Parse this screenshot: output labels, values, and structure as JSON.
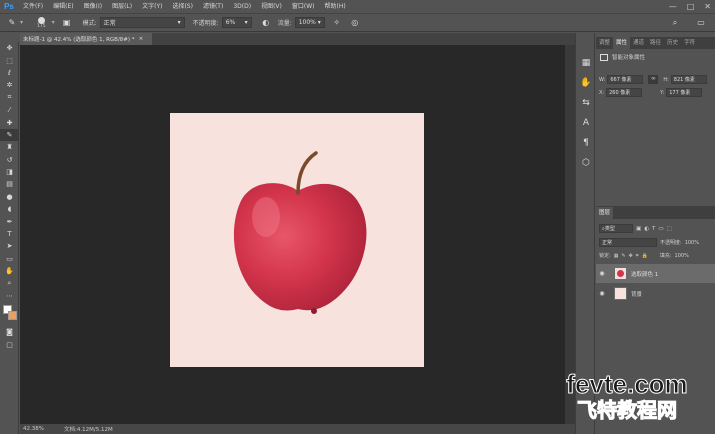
{
  "app": {
    "logo": "Ps"
  },
  "menu": [
    "文件(F)",
    "编辑(E)",
    "图像(I)",
    "图层(L)",
    "文字(Y)",
    "选择(S)",
    "滤镜(T)",
    "3D(D)",
    "视图(V)",
    "窗口(W)",
    "帮助(H)"
  ],
  "window_controls": [
    "—",
    "□",
    "✕"
  ],
  "options": {
    "brush_size": "175",
    "mode_label": "模式:",
    "mode_value": "正常",
    "opacity_label": "不透明度:",
    "opacity_value": "6%",
    "flow_label": "流量:",
    "flow_value": "100%"
  },
  "document": {
    "tab_title": "未标题-1 @ 42.4% (选取颜色 1, RGB/8#) *",
    "tab_close": "×"
  },
  "status": {
    "zoom": "42.38%",
    "doc_info": "文档:4.12M/5.12M"
  },
  "properties": {
    "tabs": [
      "调整",
      "属性",
      "通道",
      "路径",
      "历史",
      "字符"
    ],
    "active_tab": "属性",
    "title": "智能对象属性",
    "w_label": "W:",
    "w_value": "667 像素",
    "h_label": "H:",
    "h_value": "821 像素",
    "x_label": "X:",
    "x_value": "260 像素",
    "y_label": "Y:",
    "y_value": "177 像素"
  },
  "layers": {
    "tab": "图层",
    "kind_label": "类型",
    "blend_mode": "正常",
    "opacity_label": "不透明度:",
    "opacity_value": "100%",
    "lock_label": "锁定:",
    "fill_label": "填充:",
    "fill_value": "100%",
    "items": [
      {
        "name": "选取颜色 1"
      },
      {
        "name": "背景"
      }
    ]
  },
  "watermark": {
    "line1": "fevte.com",
    "line2": "飞特教程网"
  },
  "colors": {
    "artboard": "#f7e2de",
    "apple_red": "#d2344b",
    "canvas_bg": "#282828",
    "panel": "#535353"
  }
}
